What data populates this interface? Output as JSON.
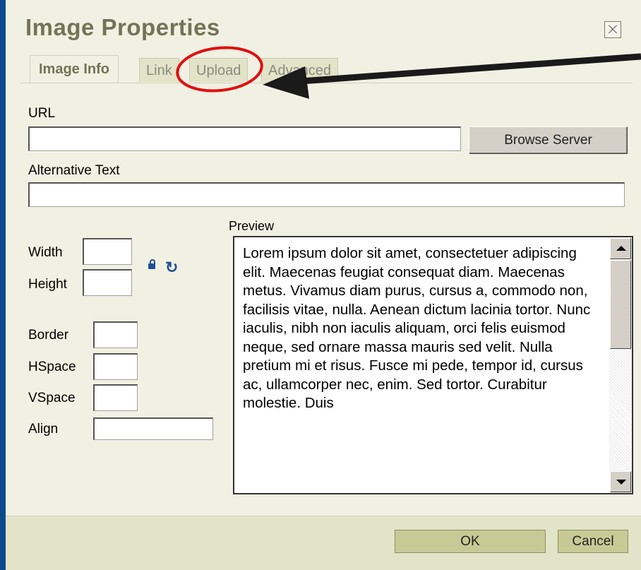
{
  "dialog": {
    "title": "Image Properties",
    "close_icon": "close-icon"
  },
  "tabs": [
    {
      "label": "Image Info",
      "active": true
    },
    {
      "label": "Link",
      "active": false
    },
    {
      "label": "Upload",
      "active": false
    },
    {
      "label": "Advanced",
      "active": false
    }
  ],
  "url": {
    "label": "URL",
    "value": "",
    "browse_label": "Browse Server"
  },
  "alt_text": {
    "label": "Alternative Text",
    "value": ""
  },
  "dimensions": {
    "width_label": "Width",
    "height_label": "Height",
    "width_value": "",
    "height_value": "",
    "lock_icon": "lock-icon",
    "reset_icon": "reset-size-icon"
  },
  "spacing": {
    "border_label": "Border",
    "hspace_label": "HSpace",
    "vspace_label": "VSpace",
    "align_label": "Align",
    "border_value": "",
    "hspace_value": "",
    "vspace_value": "",
    "align_value": ""
  },
  "preview": {
    "label": "Preview",
    "text": "Lorem ipsum dolor sit amet, consectetuer adipiscing elit. Maecenas feugiat consequat diam. Maecenas metus. Vivamus diam purus, cursus a, commodo non, facilisis vitae, nulla. Aenean dictum lacinia tortor. Nunc iaculis, nibh non iaculis aliquam, orci felis euismod neque, sed ornare massa mauris sed velit. Nulla pretium mi et risus. Fusce mi pede, tempor id, cursus ac, ullamcorper nec, enim. Sed tortor. Curabitur molestie. Duis"
  },
  "footer": {
    "ok_label": "OK",
    "cancel_label": "Cancel"
  },
  "colors": {
    "desktop": "#0b4a8e",
    "dialog_bg": "#f1f1e3",
    "title": "#737357",
    "annotation": "#e01010"
  }
}
